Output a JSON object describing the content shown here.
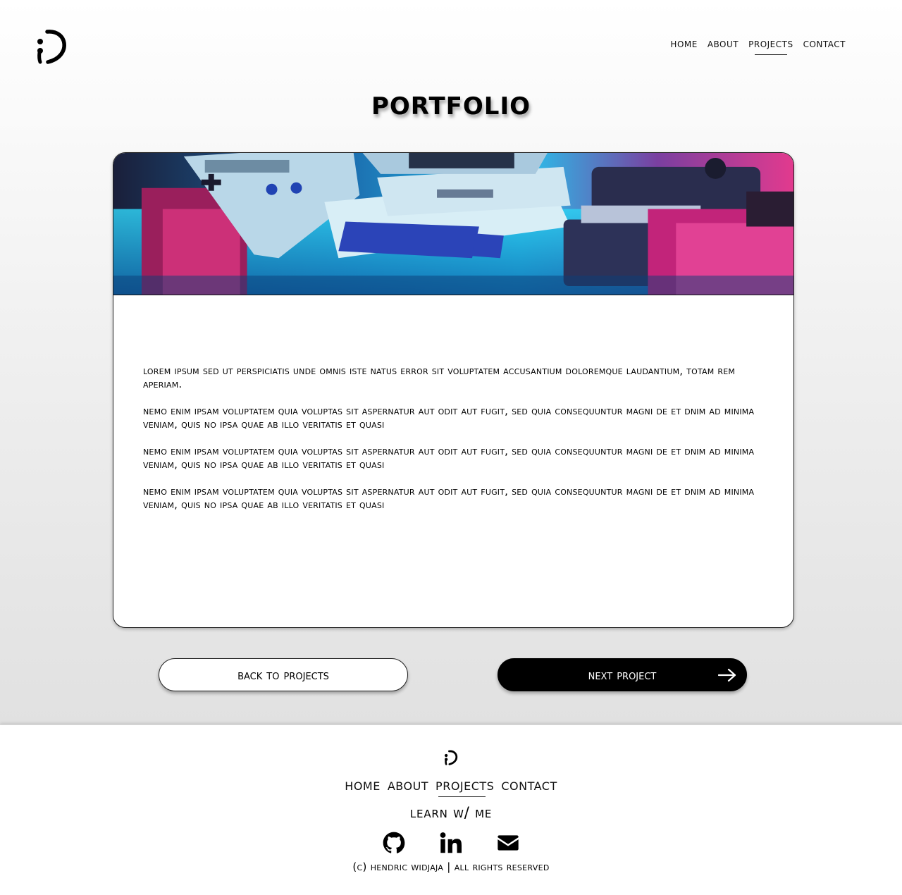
{
  "header": {
    "logo_icon": "wink-face-logo-icon",
    "nav": [
      {
        "label": "Home"
      },
      {
        "label": "About"
      },
      {
        "label": "Projects",
        "active": true
      },
      {
        "label": "Contact"
      }
    ]
  },
  "page": {
    "title": "Portfolio"
  },
  "project": {
    "hero_image": "retro-computers-photo",
    "paragraphs": [
      "Lorem ipsum Sed ut perspiciatis unde omnis iste natus error sit voluptatem accusantium doloremque laudantium, totam rem aperiam.",
      " Nemo enim ipsam voluptatem quia voluptas sit aspernatur aut odit aut fugit, sed quia consequuntur magni de et dnim ad minima veniam, quis no ipsa quae ab illo  veritatis et quasi",
      " Nemo enim ipsam voluptatem quia voluptas sit aspernatur aut odit aut fugit, sed quia consequuntur magni de et dnim ad minima veniam, quis no ipsa quae ab illo  veritatis et quasi",
      " Nemo enim ipsam voluptatem quia voluptas sit aspernatur aut odit aut fugit, sed quia consequuntur magni de et dnim ad minima veniam, quis no ipsa quae ab illo  veritatis et quasi"
    ]
  },
  "buttons": {
    "back_label": "Back to projects",
    "next_label": "Next project",
    "next_icon": "arrow-right-icon"
  },
  "footer": {
    "logo_icon": "wink-face-logo-icon",
    "nav": [
      {
        "label": "Home"
      },
      {
        "label": "About"
      },
      {
        "label": "Projects",
        "active": true
      },
      {
        "label": "Contact"
      }
    ],
    "learn_label": "Learn w/ me",
    "socials": [
      {
        "icon": "github-icon"
      },
      {
        "icon": "linkedin-icon"
      },
      {
        "icon": "email-icon"
      }
    ],
    "copyright": "(c) Hendric Widjaja | All rights reserved"
  },
  "colors": {
    "background_top": "#ffffff",
    "background_bottom": "#e1e1e1",
    "button_dark": "#000000",
    "hero_cyan": "#1fb8e8",
    "hero_magenta": "#e0338f"
  }
}
